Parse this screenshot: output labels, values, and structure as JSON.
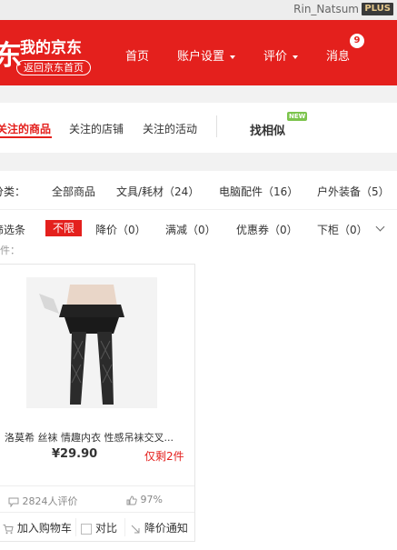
{
  "topbar": {
    "username": "Rin_Natsum",
    "plus_badge": "PLUS"
  },
  "header": {
    "logo_fragment": "东",
    "title": "我的京东",
    "back_home": "返回京东首页",
    "nav": {
      "home": "首页",
      "account_settings": "账户设置",
      "reviews": "评价",
      "messages": "消息",
      "messages_count": "9"
    }
  },
  "tabs": {
    "items": [
      "关注的商品",
      "关注的店铺",
      "关注的活动"
    ],
    "active_index": 0,
    "find_similar": "找相似",
    "new_badge": "NEW"
  },
  "filters": {
    "category_label": "分类：",
    "categories": [
      "全部商品",
      "文具/耗材（24）",
      "电脑配件（16）",
      "户外装备（5）"
    ],
    "filter_label": "筛选条",
    "unlimited": "不限",
    "options": [
      "降价（0）",
      "满减（0）",
      "优惠券（0）",
      "下柜（0）"
    ]
  },
  "content": {
    "partial_label": "件："
  },
  "product": {
    "name": "洛莫希 丝袜 情趣内衣 性感吊袜交叉...",
    "price": "¥29.90",
    "stock": "仅剩2件",
    "reviews": "2824人评价",
    "positive_rate": "97%",
    "actions": {
      "add_to_cart": "加入购物车",
      "compare": "对比",
      "price_alert": "降价通知"
    }
  },
  "colors": {
    "brand_red": "#e4201d",
    "new_badge_green": "#7cc44d"
  }
}
